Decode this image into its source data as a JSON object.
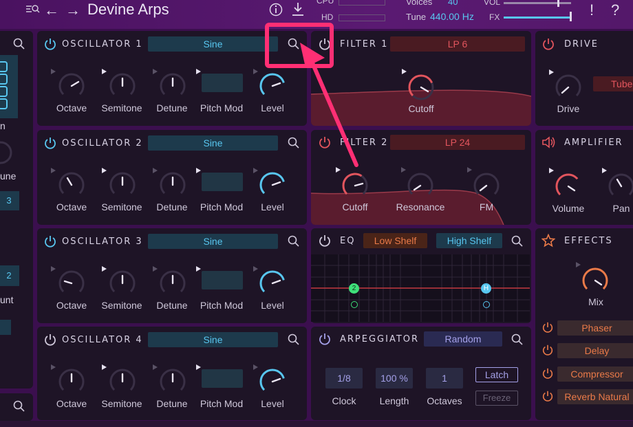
{
  "app": {
    "title": "Devine Arps"
  },
  "header": {
    "cpu_label": "CPU",
    "hd_label": "HD",
    "voices_label": "Voices",
    "voices_value": "40",
    "tune_label": "Tune",
    "tune_value": "440.00 Hz",
    "vol_label": "VOL",
    "fx_label": "FX",
    "alert_icon": "!",
    "help_icon": "?"
  },
  "left_partial": {
    "label1": "n",
    "label2": "une",
    "value1": "3",
    "value2": "2",
    "label3": "unt"
  },
  "oscillators": [
    {
      "title": "OSCILLATOR 1",
      "wave": "Sine"
    },
    {
      "title": "OSCILLATOR 2",
      "wave": "Sine"
    },
    {
      "title": "OSCILLATOR 3",
      "wave": "Sine"
    },
    {
      "title": "OSCILLATOR 4",
      "wave": "Sine"
    }
  ],
  "osc_knob_labels": [
    "Octave",
    "Semitone",
    "Detune",
    "Pitch Mod",
    "Level"
  ],
  "filter1": {
    "title": "FILTER 1",
    "type": "LP 6",
    "knob": "Cutoff"
  },
  "filter2": {
    "title": "FILTER 2",
    "type": "LP 24",
    "knobs": [
      "Cutoff",
      "Resonance",
      "FM"
    ]
  },
  "eq": {
    "title": "EQ",
    "low": "Low Shelf",
    "high": "High Shelf",
    "node_low": "2",
    "node_high": "H"
  },
  "arp": {
    "title": "ARPEGGIATOR",
    "mode": "Random",
    "clock_value": "1/8",
    "clock_label": "Clock",
    "length_value": "100 %",
    "length_label": "Length",
    "octaves_value": "1",
    "octaves_label": "Octaves",
    "latch": "Latch",
    "freeze": "Freeze"
  },
  "drive": {
    "title": "DRIVE",
    "knob": "Drive",
    "type": "Tube"
  },
  "amplifier": {
    "title": "AMPLIFIER",
    "knobs": [
      "Volume",
      "Pan"
    ]
  },
  "effects": {
    "title": "EFFECTS",
    "mix": "Mix",
    "items": [
      "Phaser",
      "Delay",
      "Compressor",
      "Reverb Natural"
    ]
  },
  "colors": {
    "accent_blue": "#58c6ef",
    "accent_red": "#e2555d",
    "accent_orange": "#ea7a48",
    "highlight": "#ff2f74"
  }
}
